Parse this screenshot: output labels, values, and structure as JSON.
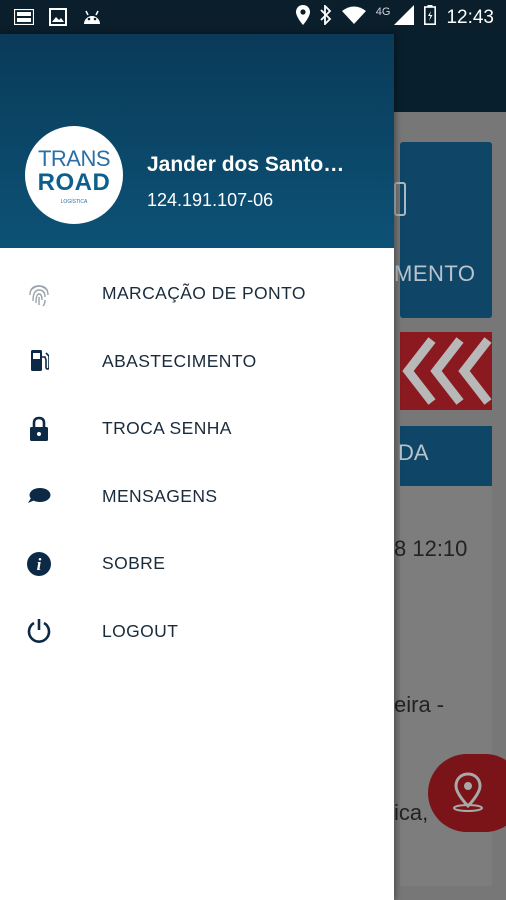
{
  "status_bar": {
    "time": "12:43",
    "network_label": "4G",
    "icons": [
      "road-notification-icon",
      "image-icon",
      "android-icon",
      "location-icon",
      "bluetooth-icon",
      "wifi-icon",
      "signal-icon",
      "battery-icon"
    ]
  },
  "drawer": {
    "logo": {
      "line1": "TRANS",
      "line2": "ROAD",
      "tagline": "LOGÍSTICA"
    },
    "user": {
      "name": "Jander dos Santo…",
      "id": "124.191.107-06"
    },
    "menu": [
      {
        "label": "MARCAÇÃO DE PONTO",
        "icon": "fingerprint-icon"
      },
      {
        "label": "ABASTECIMENTO",
        "icon": "fuel-pump-icon"
      },
      {
        "label": "TROCA SENHA",
        "icon": "lock-icon"
      },
      {
        "label": "MENSAGENS",
        "icon": "chat-bubble-icon"
      },
      {
        "label": "SOBRE",
        "icon": "info-icon"
      },
      {
        "label": "LOGOUT",
        "icon": "power-icon"
      }
    ]
  },
  "background": {
    "card1_label": "MENTO",
    "card3_label": "DA",
    "text1": "8 12:10",
    "text2": "eira -",
    "text3": "ica,"
  },
  "colors": {
    "header_dark": "#0a3a58",
    "header_light": "#0c5276",
    "menu_icon": "#0c2a45",
    "accent_red": "#8a1a1f"
  }
}
